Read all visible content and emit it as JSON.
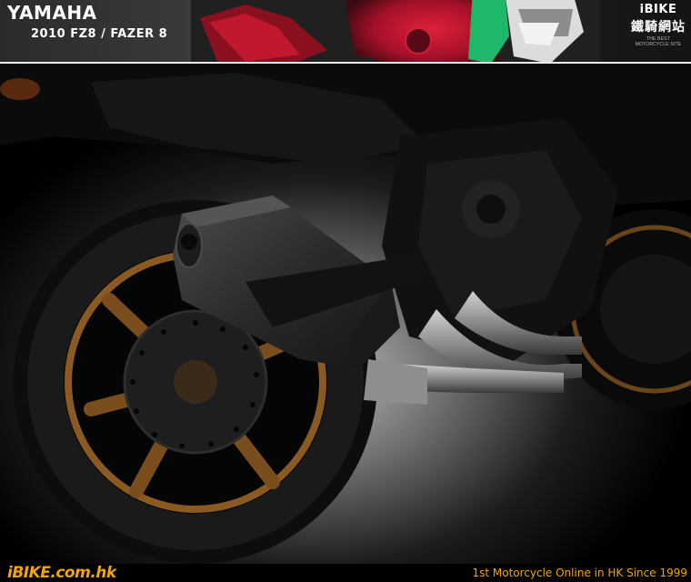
{
  "header": {
    "brand": "YAMAHA",
    "model": "2010 FZ8 / FAZER 8",
    "logo": {
      "word": "iBIKE",
      "cjk": "鐵騎網站",
      "tagline": "THE BEST MOTORCYCLE SITE"
    }
  },
  "photo": {
    "subject": "motorcycle rear wheel and exhaust",
    "colors": {
      "wheel": "#8a5a22",
      "tire": "#151515",
      "muffler": "#3a3a3a",
      "pipe": "#9a9a9a",
      "bike_body": "#b0172a"
    }
  },
  "footer": {
    "logo": "iBIKE.com.hk",
    "slogan": "1st  Motorcycle Online in HK Since 1999"
  }
}
